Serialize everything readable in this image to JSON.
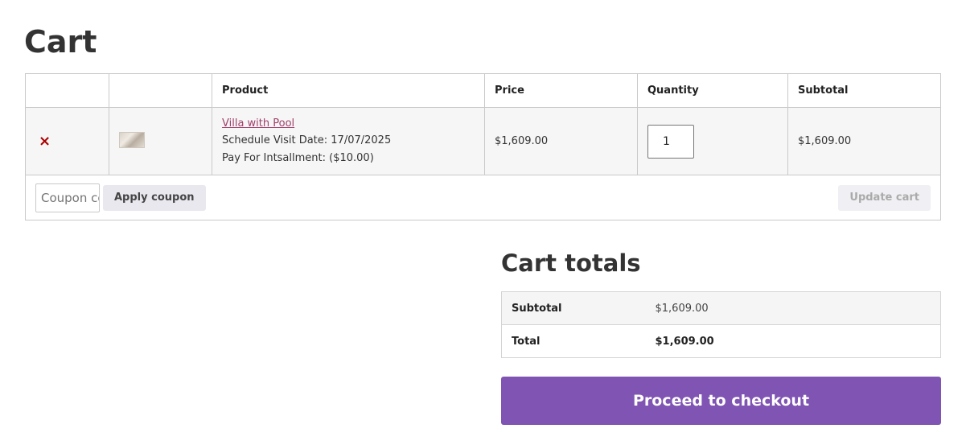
{
  "page": {
    "title": "Cart"
  },
  "cart_table": {
    "headers": {
      "remove": "",
      "thumbnail": "",
      "product": "Product",
      "price": "Price",
      "quantity": "Quantity",
      "subtotal": "Subtotal"
    },
    "items": [
      {
        "remove_icon": "×",
        "product_name": "Villa with Pool",
        "meta_lines": [
          "Schedule Visit Date: 17/07/2025",
          "Pay For Intsallment: ($10.00)"
        ],
        "price": "$1,609.00",
        "quantity": "1",
        "subtotal": "$1,609.00"
      }
    ],
    "coupon": {
      "placeholder": "Coupon code",
      "apply_label": "Apply coupon"
    },
    "update_label": "Update cart"
  },
  "cart_totals": {
    "title": "Cart totals",
    "rows": [
      {
        "label": "Subtotal",
        "value": "$1,609.00"
      },
      {
        "label": "Total",
        "value": "$1,609.00"
      }
    ],
    "checkout_label": "Proceed to checkout"
  },
  "colors": {
    "accent": "#7f54b3",
    "link": "#a0406b",
    "remove": "#aa0000"
  },
  "icons": {
    "remove": "remove-icon",
    "thumbnail": "product-thumbnail"
  }
}
